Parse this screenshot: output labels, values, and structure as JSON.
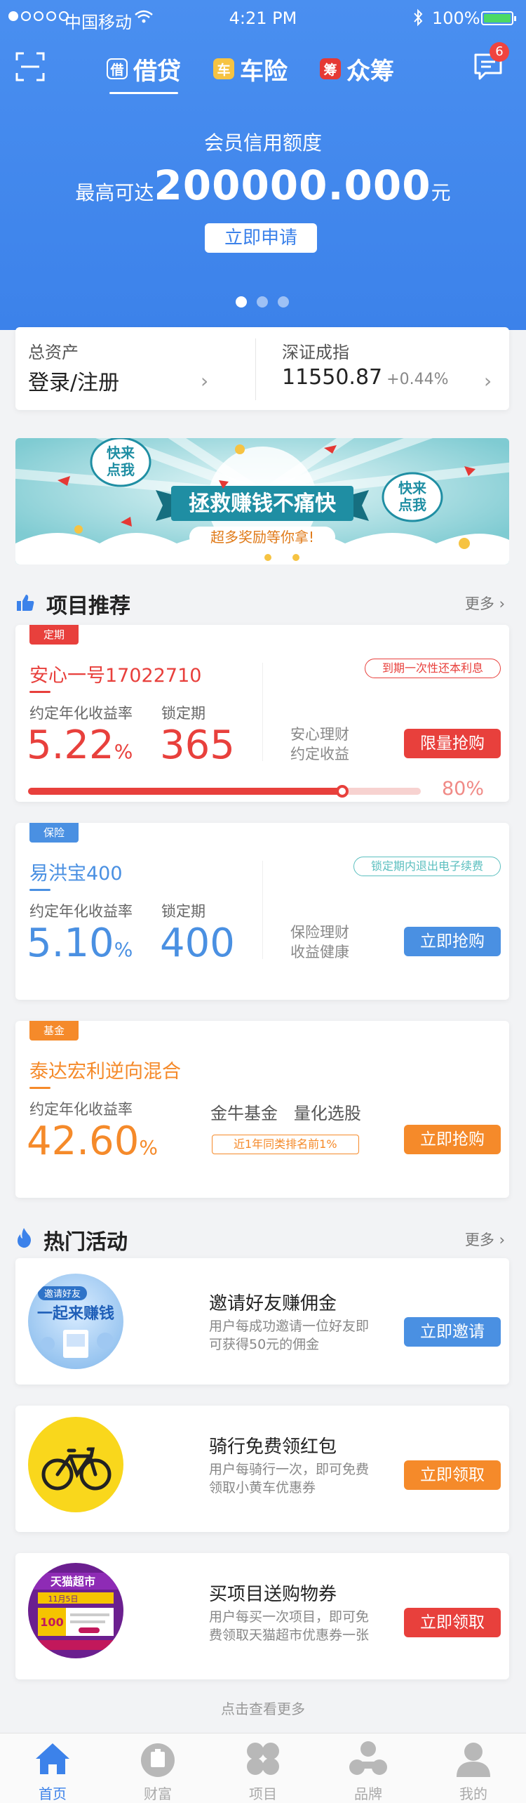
{
  "status_bar": {
    "carrier": "中国移动",
    "time": "4:21 PM",
    "battery": "100%"
  },
  "header": {
    "tabs": [
      {
        "icon": "借",
        "label": "借贷"
      },
      {
        "icon": "车",
        "label": "车险"
      },
      {
        "icon": "筹",
        "label": "众筹"
      }
    ],
    "message_badge": "6"
  },
  "hero": {
    "title": "会员信用额度",
    "prefix": "最高可达",
    "amount": "200000.000",
    "suffix": "元",
    "button": "立即申请",
    "page_dots": 3,
    "active_dot": 0
  },
  "assets": {
    "left_label": "总资产",
    "left_value": "登录/注册",
    "right_label": "深证成指",
    "right_value": "11550.87",
    "right_change": "+0.44%"
  },
  "banner": {
    "main_text": "拯救赚钱不痛快",
    "sub_text": "超多奖励等你拿!",
    "bubble_left": "快来\n点我",
    "bubble_right": "快来\n点我"
  },
  "projects": {
    "title": "项目推荐",
    "more": "更多",
    "items": [
      {
        "tag": "定期",
        "name": "安心一号17022710",
        "rate_label": "约定年化收益率",
        "rate": "5.22",
        "rate_unit": "%",
        "period_label": "锁定期",
        "period": "365",
        "desc1": "安心理财",
        "desc2": "约定收益",
        "pill": "到期一次性还本利息",
        "button": "限量抢购",
        "progress_text": "80%",
        "progress": 0.8,
        "color": "#e8403c"
      },
      {
        "tag": "保险",
        "name": "易洪宝400",
        "rate_label": "约定年化收益率",
        "rate": "5.10",
        "rate_unit": "%",
        "period_label": "锁定期",
        "period": "400",
        "desc1": "保险理财",
        "desc2": "收益健康",
        "pill": "锁定期内退出电子续费",
        "button": "立即抢购",
        "color": "#4a90e2"
      },
      {
        "tag": "基金",
        "name": "泰达宏利逆向混合",
        "rate_label": "约定年化收益率",
        "rate": "42.60",
        "rate_unit": "%",
        "feature": "金牛基金   量化选股",
        "pill": "近1年同类排名前1%",
        "button": "立即抢购",
        "color": "#f58a2a"
      }
    ]
  },
  "activities": {
    "title": "热门活动",
    "more": "更多",
    "items": [
      {
        "title": "邀请好友赚佣金",
        "desc": "用户每成功邀请一位好友即可获得50元的佣金",
        "button": "立即邀请",
        "pic_line1": "邀请好友",
        "pic_line2": "一起来赚钱",
        "color": "#4a90e2"
      },
      {
        "title": "骑行免费领红包",
        "desc": "用户每骑行一次，即可免费领取小黄车优惠券",
        "button": "立即领取",
        "color": "#f58a2a"
      },
      {
        "title": "买项目送购物券",
        "desc": "用户每买一次项目，即可免费领取天猫超市优惠券一张",
        "button": "立即领取",
        "pic_line1": "天猫超市",
        "pic_line2": "11月5日",
        "pic_line3": "100",
        "color": "#e8403c"
      }
    ],
    "footer": "点击查看更多"
  },
  "tabbar": {
    "items": [
      {
        "label": "首页",
        "icon": "home-icon"
      },
      {
        "label": "财富",
        "icon": "wealth-icon"
      },
      {
        "label": "项目",
        "icon": "project-icon"
      },
      {
        "label": "品牌",
        "icon": "brand-icon"
      },
      {
        "label": "我的",
        "icon": "profile-icon"
      }
    ],
    "active": 0,
    "active_color": "#3c82ea"
  }
}
